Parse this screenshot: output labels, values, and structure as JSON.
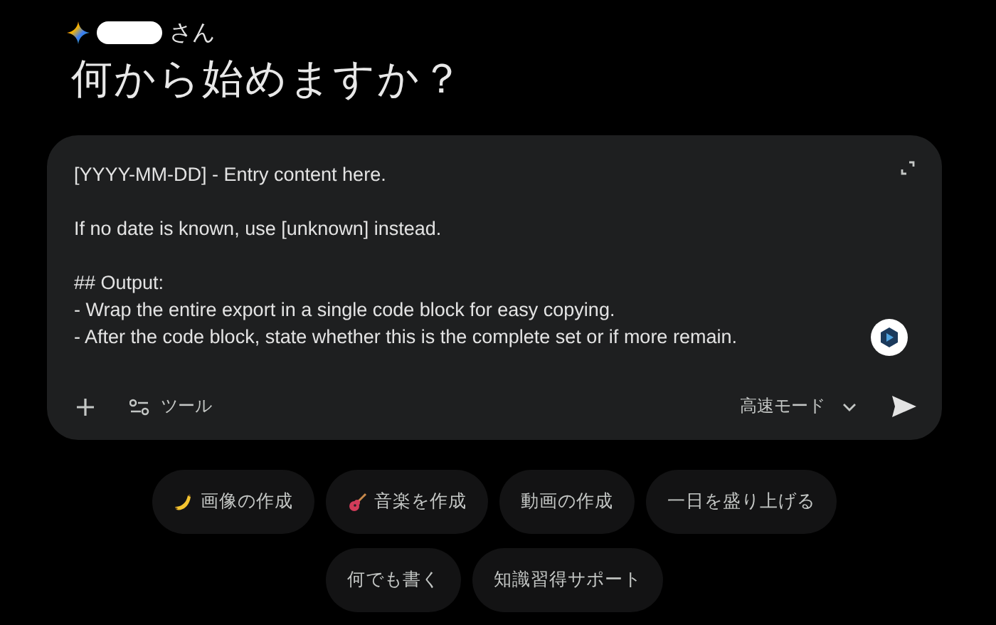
{
  "greeting": {
    "name_redacted": true,
    "suffix": "さん"
  },
  "title": "何から始めますか？",
  "prompt": {
    "paragraphs": [
      [
        "[YYYY-MM-DD] - Entry content here."
      ],
      [
        "If no date is known, use [unknown] instead."
      ],
      [
        "## Output:",
        "- Wrap the entire export in a single code block for easy copying.",
        "- After the code block, state whether this is the complete set or if more remain."
      ]
    ],
    "tools_label": "ツール",
    "mode_label": "高速モード"
  },
  "chips": [
    [
      {
        "label": "画像の作成",
        "kind": "banana"
      },
      {
        "label": "音楽を作成",
        "kind": "guitar"
      },
      {
        "label": "動画の作成",
        "kind": "plain"
      },
      {
        "label": "一日を盛り上げる",
        "kind": "plain"
      }
    ],
    [
      {
        "label": "何でも書く",
        "kind": "plain"
      },
      {
        "label": "知識習得サポート",
        "kind": "plain"
      }
    ]
  ]
}
